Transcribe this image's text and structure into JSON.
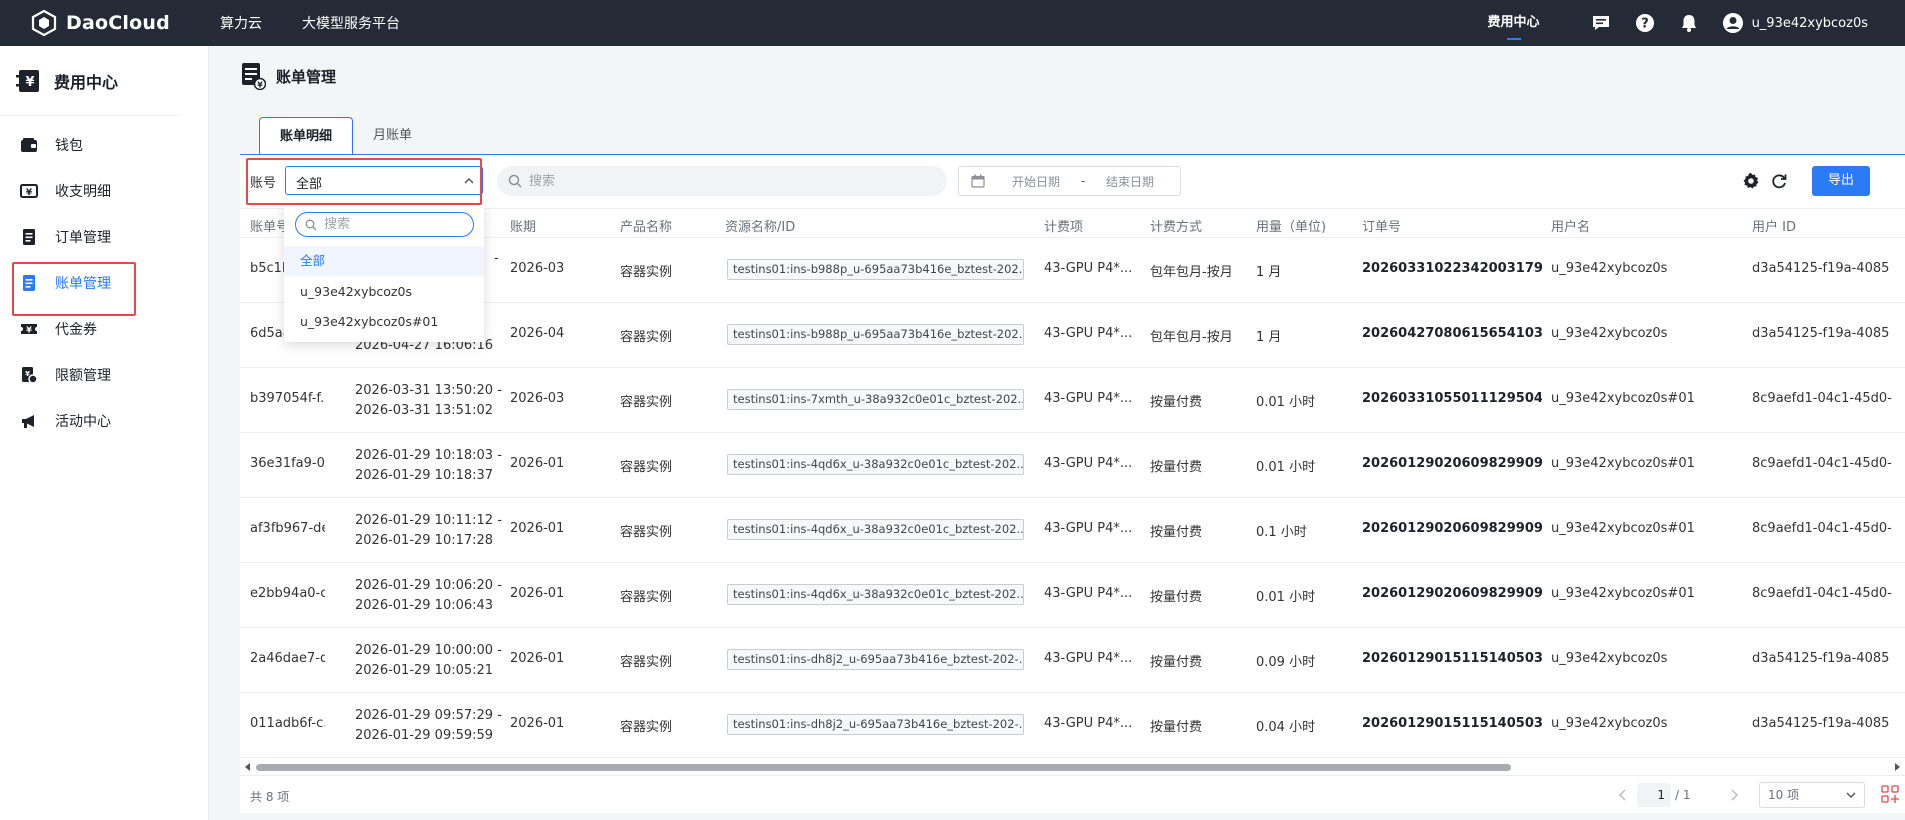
{
  "topbar": {
    "logo_text": "DaoCloud",
    "nav": [
      "算力云",
      "大模型服务平台"
    ],
    "fee_center": "费用中心",
    "username": "u_93e42xybcoz0s"
  },
  "sidebar": {
    "title": "费用中心",
    "items": [
      {
        "label": "钱包",
        "icon": "wallet-icon"
      },
      {
        "label": "收支明细",
        "icon": "income-expense-icon"
      },
      {
        "label": "订单管理",
        "icon": "order-icon"
      },
      {
        "label": "账单管理",
        "icon": "bill-icon",
        "active": true
      },
      {
        "label": "代金券",
        "icon": "voucher-icon"
      },
      {
        "label": "限额管理",
        "icon": "quota-icon"
      },
      {
        "label": "活动中心",
        "icon": "activity-icon"
      }
    ]
  },
  "page": {
    "title": "账单管理",
    "tabs": [
      "账单明细",
      "月账单"
    ]
  },
  "toolbar": {
    "account_label": "账号",
    "account_value": "全部",
    "search_placeholder": "搜索",
    "start_date_placeholder": "开始日期",
    "date_separator": "-",
    "end_date_placeholder": "结束日期",
    "export_label": "导出"
  },
  "dropdown": {
    "search_placeholder": "搜索",
    "options": [
      "全部",
      "u_93e42xybcoz0s",
      "u_93e42xybcoz0s#01"
    ],
    "selected": "全部"
  },
  "table": {
    "headers": [
      "账单号",
      "",
      "账期",
      "产品名称",
      "资源名称/ID",
      "计费项",
      "计费方式",
      "用量（单位)",
      "订单号",
      "用户名",
      "用户 ID"
    ],
    "rows": [
      {
        "bill": "b5c1b",
        "time_start": "",
        "time_end": "",
        "time_end_suffix": "-",
        "period": "2026-03",
        "product": "容器实例",
        "resource": "testins01:ins-b988p_u-695aa73b416e_bztest-202...",
        "item": "43-GPU P4*...",
        "method": "包年包月-按月",
        "usage": "1 月",
        "order": "20260331022342003179...",
        "username": "u_93e42xybcoz0s",
        "userid": "d3a54125-f19a-4085"
      },
      {
        "bill": "6d5a8",
        "time_start": "",
        "time_end": "2026-04-27 16:06:16",
        "period": "2026-04",
        "product": "容器实例",
        "resource": "testins01:ins-b988p_u-695aa73b416e_bztest-202...",
        "item": "43-GPU P4*...",
        "method": "包年包月-按月",
        "usage": "1 月",
        "order": "20260427080615654103...",
        "username": "u_93e42xybcoz0s",
        "userid": "d3a54125-f19a-4085"
      },
      {
        "bill": "b397054f-f...",
        "time_start": "2026-03-31 13:50:20 -",
        "time_end": "2026-03-31 13:51:02",
        "period": "2026-03",
        "product": "容器实例",
        "resource": "testins01:ins-7xmth_u-38a932c0e01c_bztest-202...",
        "item": "43-GPU P4*...",
        "method": "按量付费",
        "usage": "0.01 小时",
        "order": "20260331055011129504...",
        "username": "u_93e42xybcoz0s#01",
        "userid": "8c9aefd1-04c1-45d0-"
      },
      {
        "bill": "36e31fa9-0...",
        "time_start": "2026-01-29 10:18:03 -",
        "time_end": "2026-01-29 10:18:37",
        "period": "2026-01",
        "product": "容器实例",
        "resource": "testins01:ins-4qd6x_u-38a932c0e01c_bztest-202...",
        "item": "43-GPU P4*...",
        "method": "按量付费",
        "usage": "0.01 小时",
        "order": "20260129020609829909...",
        "username": "u_93e42xybcoz0s#01",
        "userid": "8c9aefd1-04c1-45d0-"
      },
      {
        "bill": "af3fb967-de...",
        "time_start": "2026-01-29 10:11:12 -",
        "time_end": "2026-01-29 10:17:28",
        "period": "2026-01",
        "product": "容器实例",
        "resource": "testins01:ins-4qd6x_u-38a932c0e01c_bztest-202...",
        "item": "43-GPU P4*...",
        "method": "按量付费",
        "usage": "0.1 小时",
        "order": "20260129020609829909...",
        "username": "u_93e42xybcoz0s#01",
        "userid": "8c9aefd1-04c1-45d0-"
      },
      {
        "bill": "e2bb94a0-c...",
        "time_start": "2026-01-29 10:06:20 -",
        "time_end": "2026-01-29 10:06:43",
        "period": "2026-01",
        "product": "容器实例",
        "resource": "testins01:ins-4qd6x_u-38a932c0e01c_bztest-202...",
        "item": "43-GPU P4*...",
        "method": "按量付费",
        "usage": "0.01 小时",
        "order": "20260129020609829909...",
        "username": "u_93e42xybcoz0s#01",
        "userid": "8c9aefd1-04c1-45d0-"
      },
      {
        "bill": "2a46dae7-d...",
        "time_start": "2026-01-29 10:00:00 -",
        "time_end": "2026-01-29 10:05:21",
        "period": "2026-01",
        "product": "容器实例",
        "resource": "testins01:ins-dh8j2_u-695aa73b416e_bztest-202-...",
        "item": "43-GPU P4*...",
        "method": "按量付费",
        "usage": "0.09 小时",
        "order": "20260129015115140503...",
        "username": "u_93e42xybcoz0s",
        "userid": "d3a54125-f19a-4085"
      },
      {
        "bill": "011adb6f-c...",
        "time_start": "2026-01-29 09:57:29 -",
        "time_end": "2026-01-29 09:59:59",
        "period": "2026-01",
        "product": "容器实例",
        "resource": "testins01:ins-dh8j2_u-695aa73b416e_bztest-202-...",
        "item": "43-GPU P4*...",
        "method": "按量付费",
        "usage": "0.04 小时",
        "order": "20260129015115140503...",
        "username": "u_93e42xybcoz0s",
        "userid": "d3a54125-f19a-4085"
      }
    ]
  },
  "pagination": {
    "total": "共 8 项",
    "current_page": "1",
    "total_pages": "/ 1",
    "page_size": "10 项"
  },
  "colors": {
    "primary": "#2b7bf6",
    "topbar_bg": "#242b36",
    "highlight_border": "#e5484d"
  }
}
